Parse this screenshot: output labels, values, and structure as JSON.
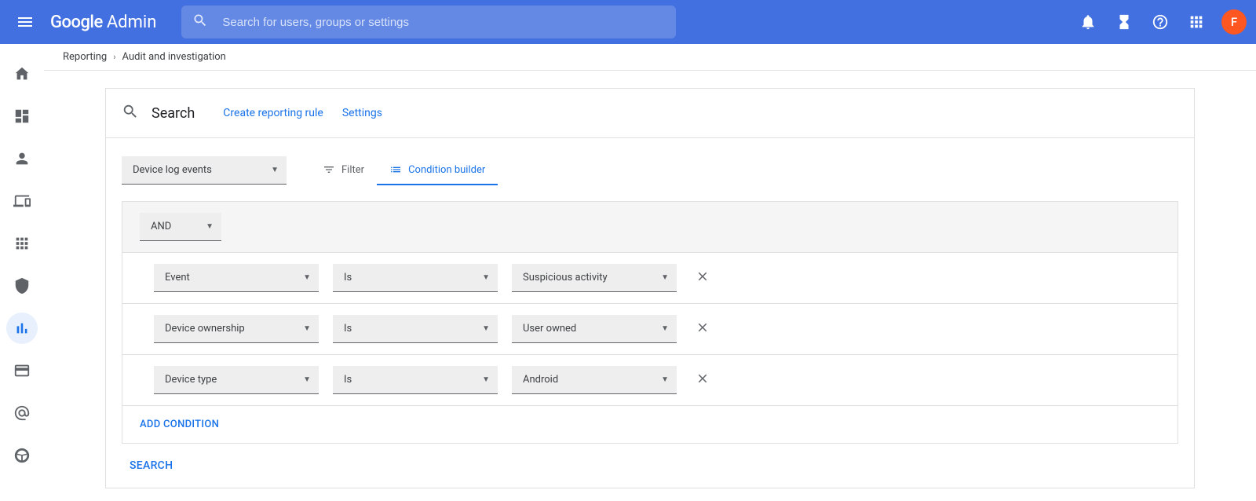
{
  "header": {
    "logo_google": "Google",
    "logo_admin": "Admin",
    "search_placeholder": "Search for users, groups or settings",
    "avatar_letter": "F"
  },
  "breadcrumb": {
    "root": "Reporting",
    "current": "Audit and investigation"
  },
  "card": {
    "title": "Search",
    "create_rule": "Create reporting rule",
    "settings": "Settings"
  },
  "source_dropdown": "Device log events",
  "tabs": {
    "filter": "Filter",
    "builder": "Condition builder"
  },
  "operator": "AND",
  "conditions": [
    {
      "field": "Event",
      "match": "Is",
      "value": "Suspicious activity"
    },
    {
      "field": "Device ownership",
      "match": "Is",
      "value": "User owned"
    },
    {
      "field": "Device type",
      "match": "Is",
      "value": "Android"
    }
  ],
  "add_condition": "ADD CONDITION",
  "search_action": "SEARCH"
}
